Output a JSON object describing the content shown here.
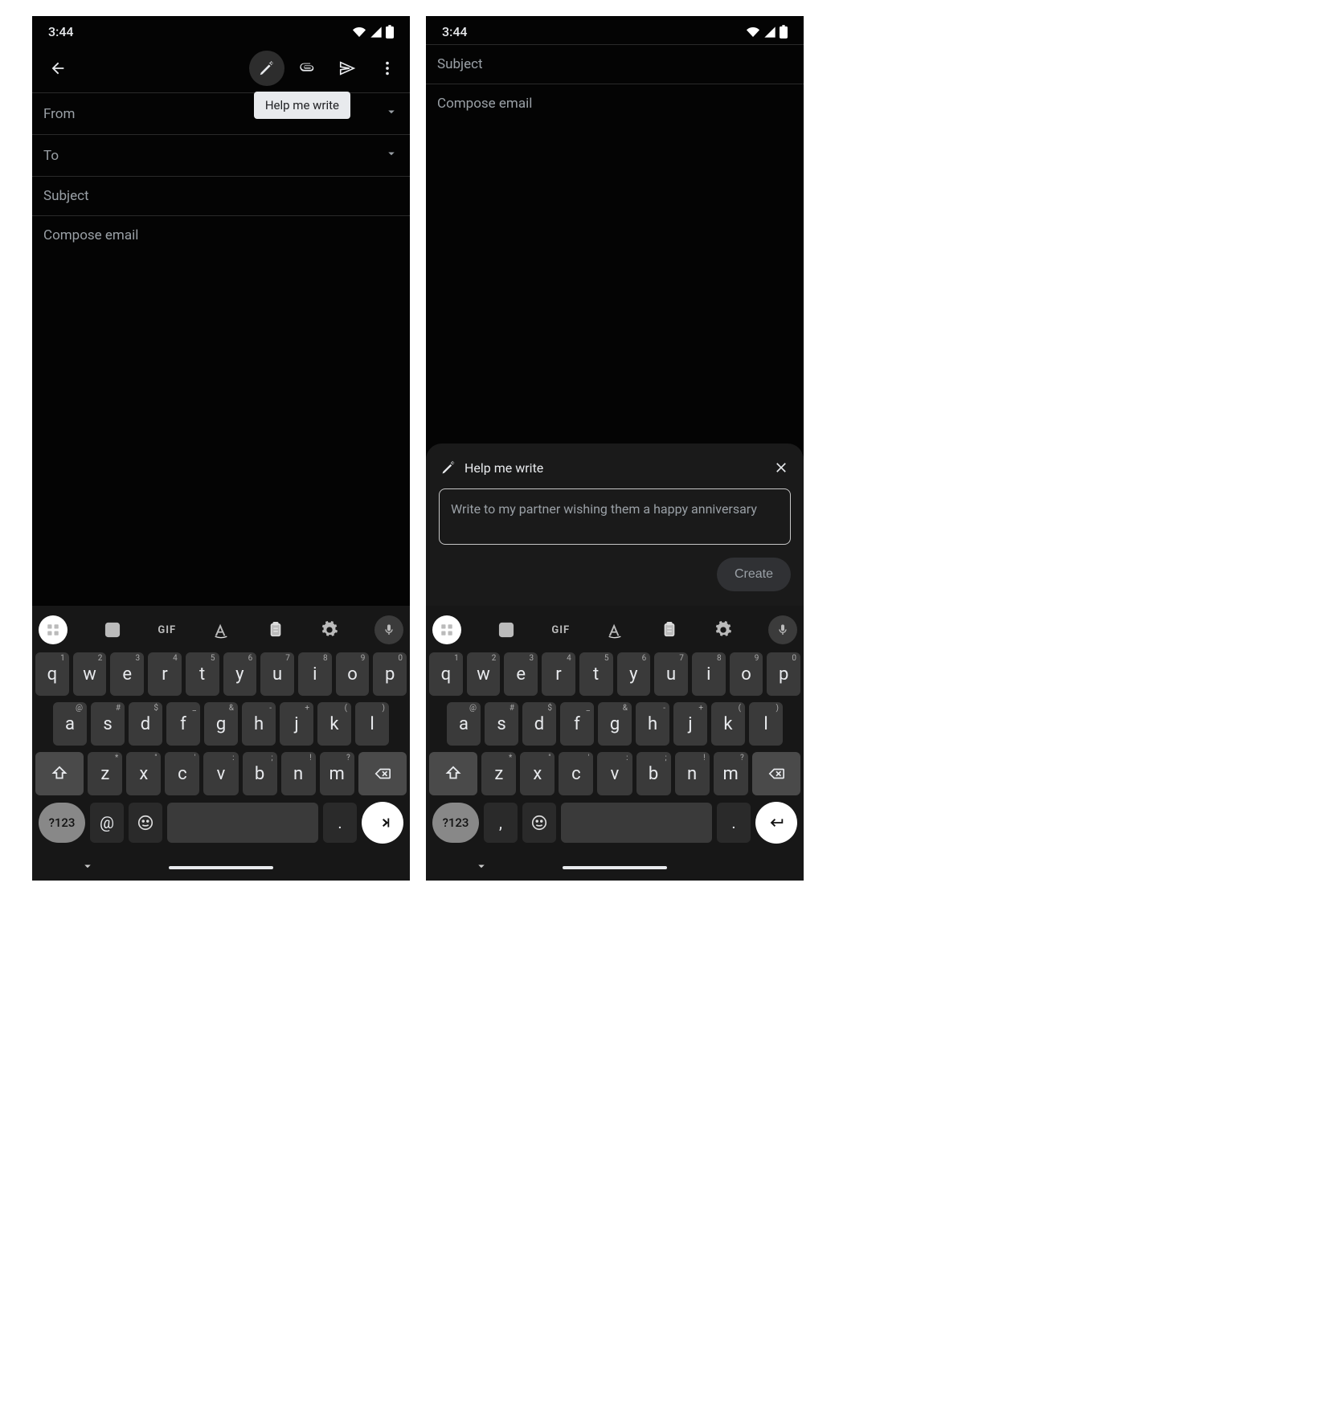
{
  "status": {
    "time": "3:44"
  },
  "toolbar": {
    "help_tooltip": "Help me write"
  },
  "fields": {
    "from_label": "From",
    "to_label": "To",
    "subject_placeholder": "Subject",
    "body_placeholder": "Compose email"
  },
  "help_panel": {
    "title": "Help me write",
    "prompt_placeholder": "Write to my partner wishing them a happy anniversary",
    "create_label": "Create"
  },
  "kb": {
    "row1": [
      {
        "k": "q",
        "s": "1"
      },
      {
        "k": "w",
        "s": "2"
      },
      {
        "k": "e",
        "s": "3"
      },
      {
        "k": "r",
        "s": "4"
      },
      {
        "k": "t",
        "s": "5"
      },
      {
        "k": "y",
        "s": "6"
      },
      {
        "k": "u",
        "s": "7"
      },
      {
        "k": "i",
        "s": "8"
      },
      {
        "k": "o",
        "s": "9"
      },
      {
        "k": "p",
        "s": "0"
      }
    ],
    "row2": [
      {
        "k": "a",
        "s": "@"
      },
      {
        "k": "s",
        "s": "#"
      },
      {
        "k": "d",
        "s": "$"
      },
      {
        "k": "f",
        "s": "_"
      },
      {
        "k": "g",
        "s": "&"
      },
      {
        "k": "h",
        "s": "-"
      },
      {
        "k": "j",
        "s": "+"
      },
      {
        "k": "k",
        "s": "("
      },
      {
        "k": "l",
        "s": ")"
      }
    ],
    "row3": [
      {
        "k": "z",
        "s": "*"
      },
      {
        "k": "x",
        "s": "\""
      },
      {
        "k": "c",
        "s": "'"
      },
      {
        "k": "v",
        "s": ":"
      },
      {
        "k": "b",
        "s": ";"
      },
      {
        "k": "n",
        "s": "!"
      },
      {
        "k": "m",
        "s": "?"
      }
    ],
    "num_label": "?123",
    "sym1_left": "@",
    "sym1_right": ",",
    "emoji": "☺",
    "dot": "."
  }
}
